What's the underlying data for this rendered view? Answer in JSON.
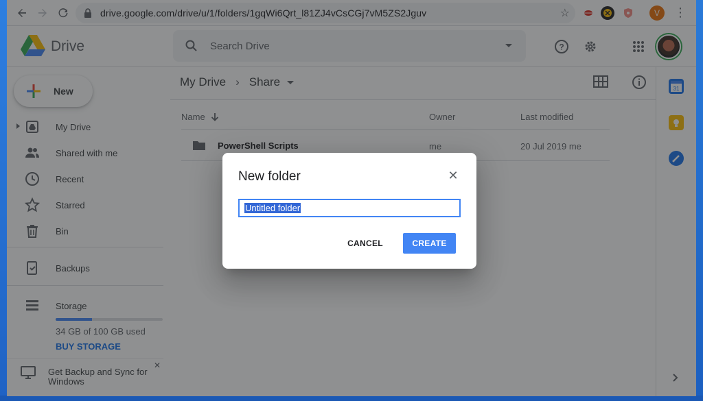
{
  "browser": {
    "url": "drive.google.com/drive/u/1/folders/1gqWi6Qrt_l81ZJ4vCsCGj7vM5ZS2Jguv",
    "profile_initial": "V"
  },
  "header": {
    "app_name": "Drive",
    "search_placeholder": "Search Drive"
  },
  "sidebar": {
    "new_label": "New",
    "items": [
      {
        "label": "My Drive"
      },
      {
        "label": "Shared with me"
      },
      {
        "label": "Recent"
      },
      {
        "label": "Starred"
      },
      {
        "label": "Bin"
      },
      {
        "label": "Backups"
      },
      {
        "label": "Storage"
      }
    ],
    "storage_used": "34 GB of 100 GB used",
    "storage_fraction": 0.34,
    "buy_storage": "BUY STORAGE",
    "promo_text": "Get Backup and Sync for Windows"
  },
  "main": {
    "breadcrumb": [
      "My Drive",
      "Share"
    ],
    "columns": {
      "name": "Name",
      "owner": "Owner",
      "modified": "Last modified"
    },
    "files": [
      {
        "name": "PowerShell Scripts",
        "owner": "me",
        "modified": "20 Jul 2019 me"
      }
    ]
  },
  "dialog": {
    "title": "New folder",
    "input_value": "Untitled folder",
    "cancel": "CANCEL",
    "create": "CREATE"
  },
  "colors": {
    "accent": "#4285f4",
    "link": "#1a73e8"
  }
}
